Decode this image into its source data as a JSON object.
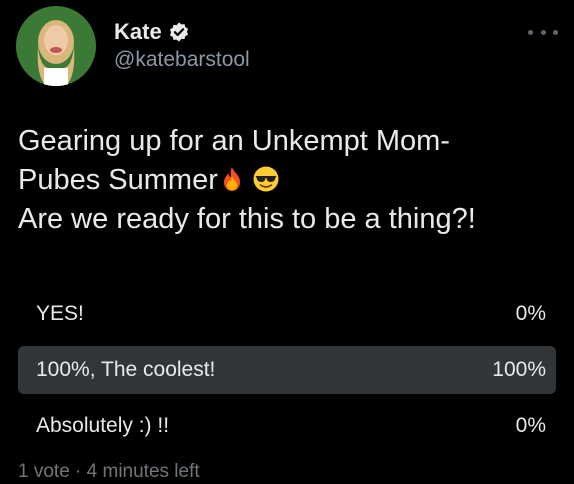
{
  "author": {
    "display_name": "Kate",
    "handle": "@katebarstool",
    "verified": true
  },
  "tweet": {
    "line1": "Gearing up for an Unkempt Mom-",
    "line2": "Pubes Summer",
    "line2_emojis": [
      "fire-emoji",
      "sunglasses-emoji"
    ],
    "line3": "Are we ready for this to be a thing?!"
  },
  "poll": {
    "choices": [
      {
        "label": "YES!",
        "percent_text": "0%",
        "percent": 0,
        "winner": false
      },
      {
        "label": "100%, The coolest!",
        "percent_text": "100%",
        "percent": 100,
        "winner": true
      },
      {
        "label": "Absolutely :) !!",
        "percent_text": "0%",
        "percent": 0,
        "winner": false
      }
    ],
    "meta": "1 vote · 4 minutes left"
  },
  "colors": {
    "background": "#000000",
    "text": "#e7e9ea",
    "secondary_text": "#8b98a5",
    "winner_bar": "#333639",
    "verified_badge": "#e7e9ea"
  },
  "icons": [
    "more-options-icon",
    "verified-badge-icon"
  ]
}
